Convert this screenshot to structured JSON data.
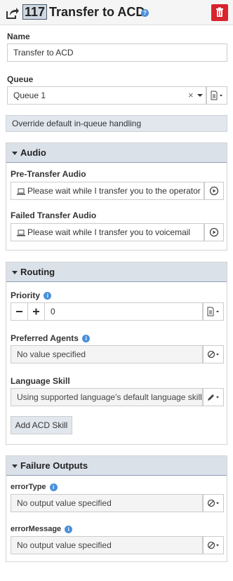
{
  "header": {
    "step_number": "117",
    "title": "Transfer to ACD"
  },
  "name": {
    "label": "Name",
    "value": "Transfer to ACD"
  },
  "queue": {
    "label": "Queue",
    "value": "Queue 1",
    "clear_glyph": "×"
  },
  "override": {
    "label": "Override default in-queue handling"
  },
  "audio": {
    "title": "Audio",
    "pre_transfer_label": "Pre-Transfer Audio",
    "pre_transfer_value": "Please wait while I transfer you to the operator",
    "failed_label": "Failed Transfer Audio",
    "failed_value": "Please wait while I transfer you to voicemail"
  },
  "routing": {
    "title": "Routing",
    "priority_label": "Priority",
    "priority_value": "0",
    "preferred_label": "Preferred Agents",
    "preferred_value": "No value specified",
    "language_label": "Language Skill",
    "language_value": "Using supported language's default language skill",
    "add_skill_label": "Add ACD Skill"
  },
  "failure": {
    "title": "Failure Outputs",
    "error_type_label": "errorType",
    "error_type_value": "No output value specified",
    "error_message_label": "errorMessage",
    "error_message_value": "No output value specified"
  },
  "colors": {
    "accent": "#4a90d9",
    "danger": "#d9232d",
    "section_header": "#dbe1e9"
  }
}
